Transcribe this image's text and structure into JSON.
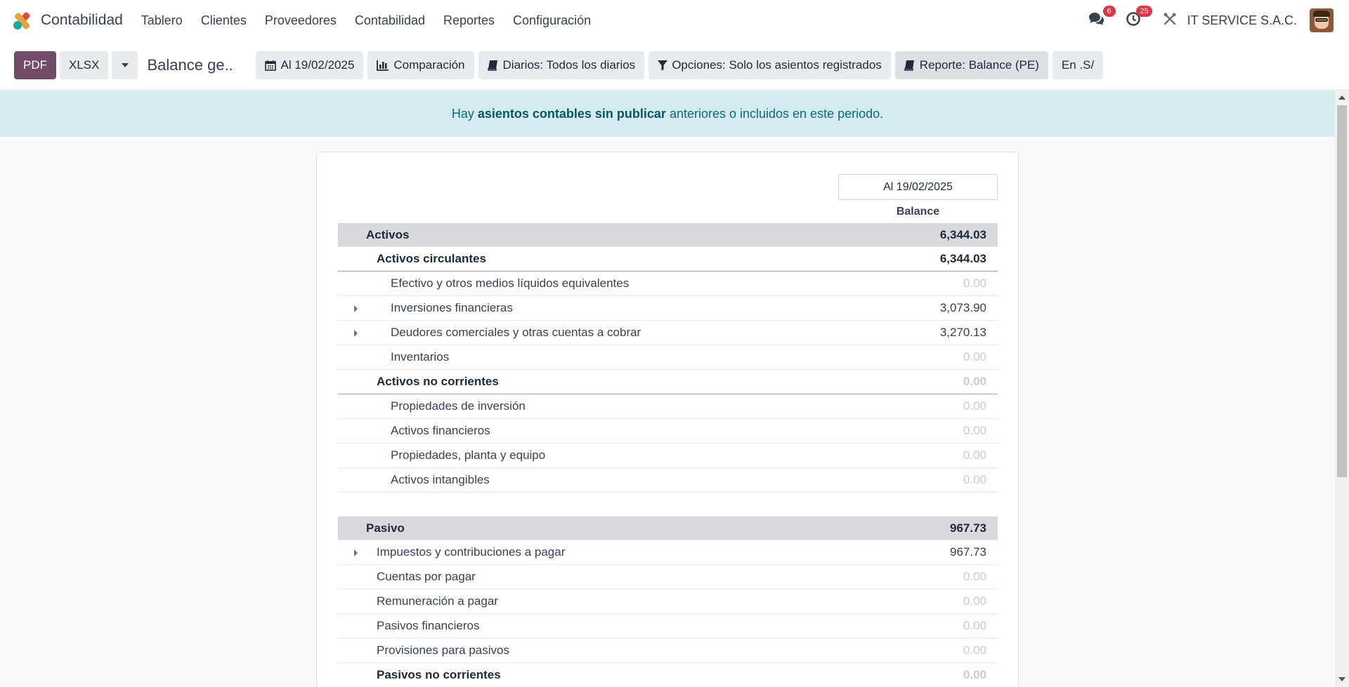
{
  "navbar": {
    "app_name": "Contabilidad",
    "menu": [
      "Tablero",
      "Clientes",
      "Proveedores",
      "Contabilidad",
      "Reportes",
      "Configuración"
    ],
    "messages_count": "6",
    "activities_count": "25",
    "company": "IT SERVICE S.A.C."
  },
  "toolbar": {
    "pdf": "PDF",
    "xlsx": "XLSX",
    "breadcrumb": "Balance ge...",
    "filters": {
      "date": "Al 19/02/2025",
      "comparison": "Comparación",
      "journals": "Diarios: Todos los diarios",
      "options": "Opciones: Solo los asientos registrados",
      "report": "Reporte: Balance (PE)",
      "currency": "En .S/"
    }
  },
  "alert": {
    "prefix": "Hay",
    "link": "asientos contables sin publicar",
    "suffix": "anteriores o incluidos en este periodo."
  },
  "report": {
    "date_header": "Al 19/02/2025",
    "column_header": "Balance",
    "rows": [
      {
        "name": "Activos",
        "value": "6,344.03"
      },
      {
        "name": "Activos circulantes",
        "value": "6,344.03"
      },
      {
        "name": "Efectivo y otros medios líquidos equivalentes",
        "value": "0.00"
      },
      {
        "name": "Inversiones financieras",
        "value": "3,073.90"
      },
      {
        "name": "Deudores comerciales y otras cuentas a cobrar",
        "value": "3,270.13"
      },
      {
        "name": "Inventarios",
        "value": "0.00"
      },
      {
        "name": "Activos no corrientes",
        "value": "0.00"
      },
      {
        "name": "Propiedades de inversión",
        "value": "0.00"
      },
      {
        "name": "Activos financieros",
        "value": "0.00"
      },
      {
        "name": "Propiedades, planta y equipo",
        "value": "0.00"
      },
      {
        "name": "Activos intangibles",
        "value": "0.00"
      },
      {
        "name": "Pasivo",
        "value": "967.73"
      },
      {
        "name": "Impuestos y contribuciones a pagar",
        "value": "967.73"
      },
      {
        "name": "Cuentas por pagar",
        "value": "0.00"
      },
      {
        "name": "Remuneración a pagar",
        "value": "0.00"
      },
      {
        "name": "Pasivos financieros",
        "value": "0.00"
      },
      {
        "name": "Provisiones para pasivos",
        "value": "0.00"
      },
      {
        "name": "Pasivos no corrientes",
        "value": "0.00"
      }
    ]
  }
}
